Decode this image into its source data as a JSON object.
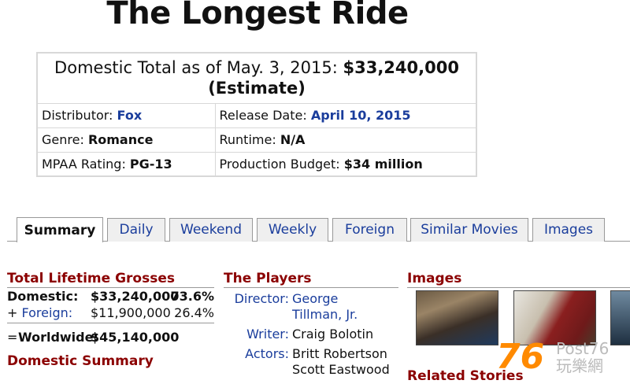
{
  "movie_title": "The Longest Ride",
  "summary": {
    "total_prefix": "Domestic Total as of May. 3, 2015:",
    "total_value": "$33,240,000",
    "total_note": "(Estimate)",
    "distributor_label": "Distributor:",
    "distributor": "Fox",
    "release_label": "Release Date:",
    "release": "April 10, 2015",
    "genre_label": "Genre:",
    "genre": "Romance",
    "runtime_label": "Runtime:",
    "runtime": "N/A",
    "mpaa_label": "MPAA Rating:",
    "mpaa": "PG-13",
    "budget_label": "Production Budget:",
    "budget": "$34 million"
  },
  "tabs": [
    "Summary",
    "Daily",
    "Weekend",
    "Weekly",
    "Foreign",
    "Similar Movies",
    "Images"
  ],
  "grosses": {
    "heading": "Total Lifetime Grosses",
    "domestic_label": "Domestic:",
    "domestic_value": "$33,240,000",
    "domestic_pct": "73.6%",
    "foreign_plus": "+",
    "foreign_label": "Foreign:",
    "foreign_value": "$11,900,000",
    "foreign_pct": "26.4%",
    "ww_eq": "=",
    "ww_label": "Worldwide:",
    "ww_value": "$45,140,000",
    "domestic_summary": "Domestic Summary"
  },
  "players": {
    "heading": "The Players",
    "director_label": "Director:",
    "director": "George Tillman, Jr.",
    "writer_label": "Writer:",
    "writer": "Craig Bolotin",
    "actors_label": "Actors:",
    "actor1": "Britt Robertson",
    "actor2": "Scott Eastwood"
  },
  "images": {
    "heading": "Images",
    "related": "Related Stories"
  },
  "watermark": {
    "number": "76",
    "text_top": "Post76",
    "text_bottom": "玩樂網"
  }
}
